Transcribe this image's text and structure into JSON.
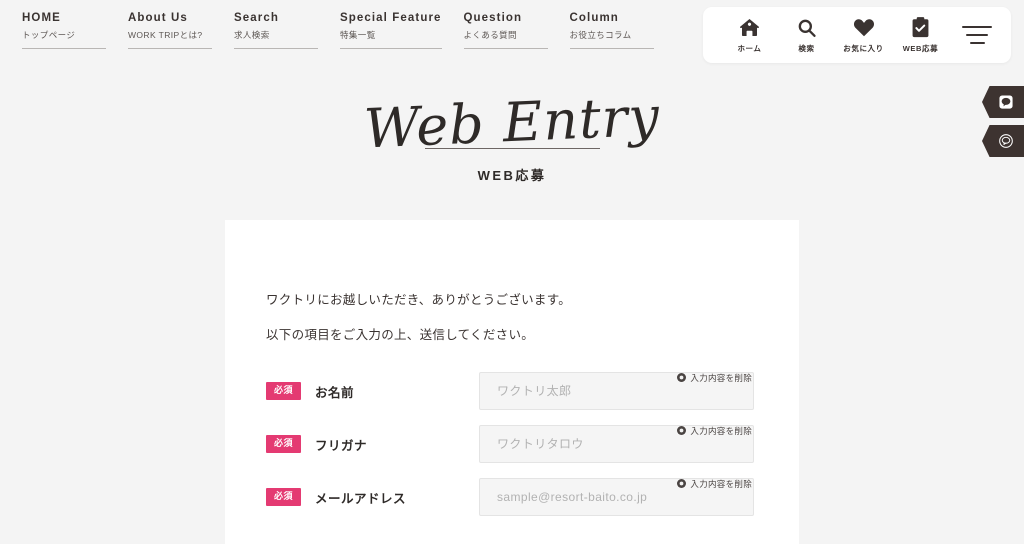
{
  "nav": {
    "items": [
      {
        "en": "HOME",
        "ja": "トップページ"
      },
      {
        "en": "About Us",
        "ja": "WORK TRIPとは?"
      },
      {
        "en": "Search",
        "ja": "求人検索"
      },
      {
        "en": "Special Feature",
        "ja": "特集一覧"
      },
      {
        "en": "Question",
        "ja": "よくある質問"
      },
      {
        "en": "Column",
        "ja": "お役立ちコラム"
      }
    ]
  },
  "icon_pill": {
    "items": [
      {
        "icon": "home-icon",
        "label": "ホーム"
      },
      {
        "icon": "search-icon",
        "label": "検索"
      },
      {
        "icon": "heart-icon",
        "label": "お気に入り"
      },
      {
        "icon": "clipboard-check-icon",
        "label": "WEB応募"
      }
    ],
    "menu_icon": "hamburger-menu-icon"
  },
  "page_head": {
    "script_title": "Web Entry",
    "subtitle": "WEB応募"
  },
  "card": {
    "lead_1": "ワクトリにお越しいただき、ありがとうございます。",
    "lead_2": "以下の項目をご入力の上、送信してください。",
    "clear_label": "入力内容を削除",
    "fields": [
      {
        "badge": "必須",
        "label": "お名前",
        "placeholder": "ワクトリ太郎",
        "value": "",
        "clear_label": "入力内容を削除"
      },
      {
        "badge": "必須",
        "label": "フリガナ",
        "placeholder": "ワクトリタロウ",
        "value": "",
        "clear_label": "入力内容を削除"
      },
      {
        "badge": "必須",
        "label": "メールアドレス",
        "placeholder": "sample@resort-baito.co.jp",
        "value": "",
        "clear_label": "入力内容を削除"
      }
    ]
  },
  "side_tabs": [
    {
      "icon": "chat-bubble-icon"
    },
    {
      "icon": "line-app-icon"
    }
  ],
  "colors": {
    "page_background": "#f4f4f4",
    "card_background": "#ffffff",
    "required_badge": "#e43a72",
    "text": "#3a3331",
    "side_tab": "#3d3330",
    "input_background": "#f5f5f5"
  }
}
